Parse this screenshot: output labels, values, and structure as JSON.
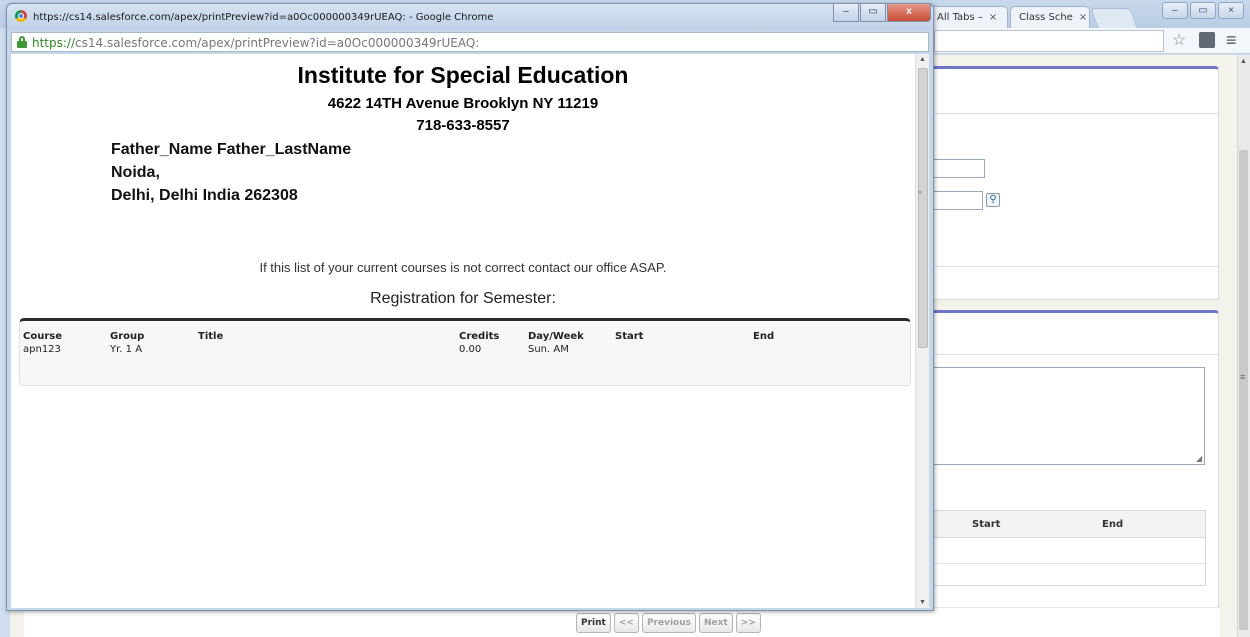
{
  "background_window": {
    "tabs": [
      {
        "label": "All Tabs –"
      },
      {
        "label": "Class Sche"
      }
    ],
    "table": {
      "headers": [
        "Start",
        "End"
      ]
    },
    "pager": {
      "print": "Print",
      "first": "<<",
      "previous": "Previous",
      "next": "Next",
      "last": ">>"
    }
  },
  "popup": {
    "title": "https://cs14.salesforce.com/apex/printPreview?id=a0Oc000000349rUEAQ: - Google Chrome",
    "url_scheme": "https://",
    "url_rest": "cs14.salesforce.com/apex/printPreview?id=a0Oc000000349rUEAQ:",
    "document": {
      "school_name": "Institute for Special Education",
      "school_address": "4622 14TH Avenue Brooklyn NY 11219",
      "school_phone": "718-633-8557",
      "recipient_name": "Father_Name Father_LastName",
      "recipient_city": "Noida,",
      "recipient_region": "Delhi, Delhi India 262308",
      "notice": "If this list of your current courses is not correct contact our office ASAP.",
      "registration_title": "Registration for Semester:",
      "course_table": {
        "headers": {
          "course": "Course",
          "group": "Group",
          "title": "Title",
          "credits": "Credits",
          "day_week": "Day/Week",
          "start": "Start",
          "end": "End"
        },
        "rows": [
          {
            "course": "apn123",
            "group": "Yr. 1 A",
            "title": "",
            "credits": "0.00",
            "day_week": "Sun. AM",
            "start": "",
            "end": ""
          }
        ]
      }
    }
  }
}
